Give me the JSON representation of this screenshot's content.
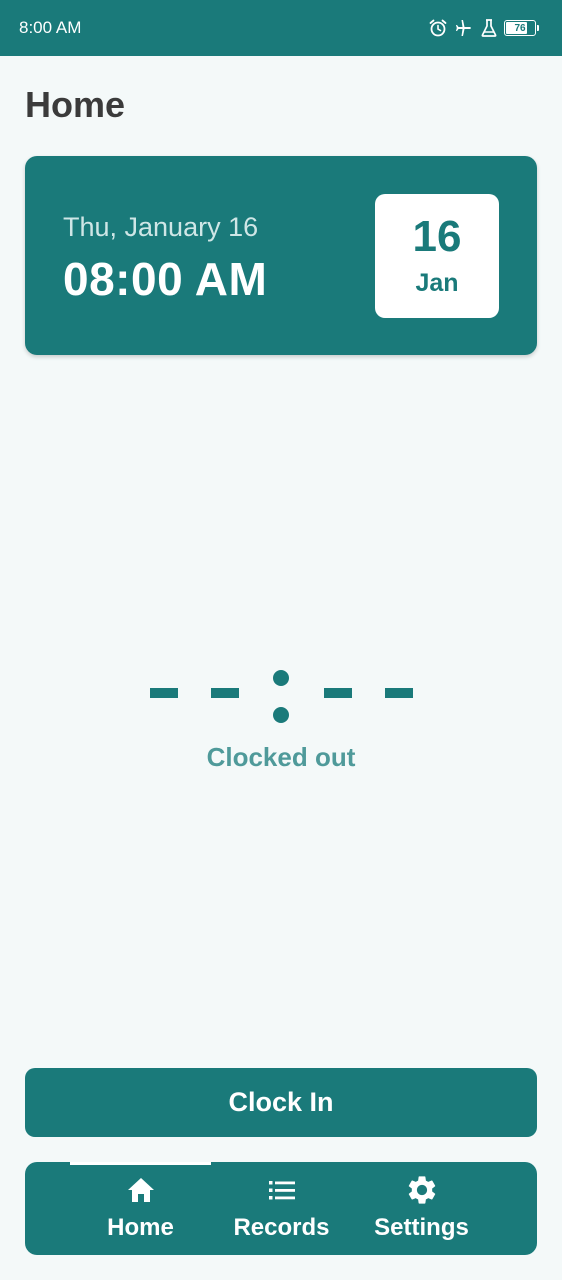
{
  "status_bar": {
    "time": "8:00 AM",
    "icons": [
      "alarm-icon",
      "airplane-icon",
      "flask-icon"
    ],
    "battery_level": 76,
    "battery_label": "76"
  },
  "page": {
    "title": "Home"
  },
  "date_card": {
    "weekday_date": "Thu, January 16",
    "time": "08:00 AM",
    "badge_day": "16",
    "badge_month": "Jan"
  },
  "timer": {
    "display": "--:--",
    "status": "Clocked out"
  },
  "actions": {
    "clock_in_label": "Clock In"
  },
  "nav": {
    "items": [
      {
        "label": "Home",
        "icon": "home-icon",
        "active": true
      },
      {
        "label": "Records",
        "icon": "list-icon",
        "active": false
      },
      {
        "label": "Settings",
        "icon": "gear-icon",
        "active": false
      }
    ]
  },
  "colors": {
    "primary": "#1a7a7a",
    "background": "#f4f9f9",
    "status_text": "#4f9a9a",
    "title_text": "#3b3b3b"
  }
}
